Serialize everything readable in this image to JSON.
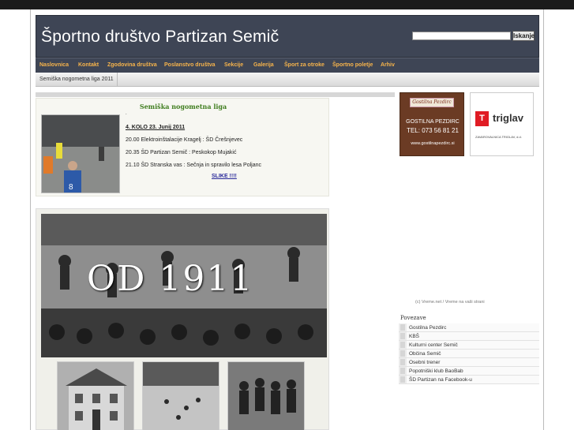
{
  "header": {
    "site_title": "Športno društvo Partizan Semič",
    "search_value": "",
    "search_button": "Iskanje"
  },
  "nav": {
    "items": [
      "Naslovnica",
      "Kontakt",
      "Zgodovina društva",
      "Poslanstvo društva",
      "Sekcije",
      "Galerija",
      "Šport za otroke",
      "Športno poletje",
      "Arhiv"
    ]
  },
  "subnav": {
    "items": [
      "Semiška nogometna liga 2011"
    ]
  },
  "article": {
    "title": "Semiška nogometna liga",
    "dot": ".",
    "round": "4. KOLO 23. Junij 2011",
    "matches": [
      "20.00  Elektroinštalacije Kragelj : ŠD Črešnjevec",
      "20.35  ŠD Partizan Semič : Peskokop Mujakić",
      "21.10  ŠD Stranska vas : Sečnja in spravilo lesa Poljanc"
    ],
    "link": "SLIKE  !!!!",
    "thumb_number": "8"
  },
  "photos": {
    "banner_text": "OD 1911"
  },
  "ads": {
    "pezdirc": {
      "logo": "Gostilna Pezdirc",
      "name": "GOSTILNA PEZDIRC",
      "tel": "TEL: 073 56 81 21",
      "web": "www.gostilnapezdirc.si"
    },
    "triglav": {
      "mark": "T",
      "name": "triglav",
      "sub": "ZAVAROVALNICA TRIGLAV, d.d."
    }
  },
  "weather": "(c) Vreme.net / Vreme na vaši strani",
  "links": {
    "title": "Povezave",
    "items": [
      "Gostilna Pezdirc",
      "KBŠ",
      "Kulturni center Semič",
      "Občina Semič",
      "Osebni trener",
      "Popotniški klub BaoBab",
      "ŠD Partizan na Facebook-u"
    ]
  },
  "colors": {
    "header_bg": "#3e4555",
    "nav_text": "#f7b44b",
    "article_title": "#3f7d1f",
    "triglav_red": "#e01c24"
  }
}
